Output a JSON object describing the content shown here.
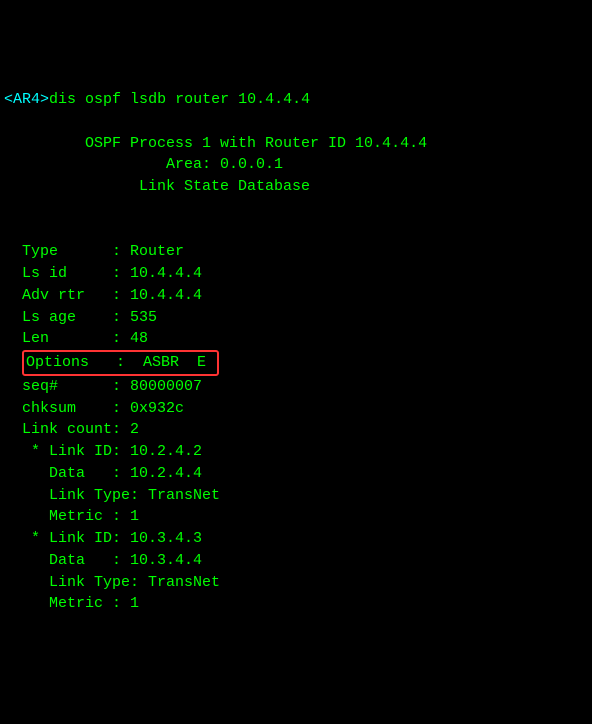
{
  "prompt": {
    "hostname_open": "<",
    "hostname": "AR4",
    "hostname_close": ">",
    "command": "dis ospf lsdb router 10.4.4.4"
  },
  "header": {
    "line1": "         OSPF Process 1 with Router ID 10.4.4.4",
    "line2": "                  Area: 0.0.0.1",
    "line3": "               Link State Database"
  },
  "lsa": {
    "indent": "  ",
    "fields1": {
      "type_key": "Type      ",
      "type_sep": ": ",
      "type_val": "Router",
      "lsid_key": "Ls id     ",
      "lsid_sep": ": ",
      "lsid_val": "10.4.4.4",
      "adv_key": "Adv rtr   ",
      "adv_sep": ": ",
      "adv_val": "10.4.4.4",
      "lsage_key": "Ls age    ",
      "lsage_sep": ": ",
      "lsage_val": "535",
      "len_key": "Len       ",
      "len_sep": ": ",
      "len_val": "48"
    },
    "options": {
      "key": "Options   ",
      "sep": ":",
      "val": "  ASBR  E "
    },
    "fields2": {
      "seq_key": "seq#      ",
      "seq_sep": ": ",
      "seq_val": "80000007",
      "chk_key": "chksum    ",
      "chk_sep": ": ",
      "chk_val": "0x932c",
      "lc_key": "Link count",
      "lc_sep": ": ",
      "lc_val": "2"
    }
  },
  "links": {
    "indent": "   ",
    "sub_indent": "     ",
    "l1": {
      "linkid_key": "* Link ID: ",
      "linkid_val": "10.2.4.2",
      "data_key": "Data   : ",
      "data_val": "10.2.4.4",
      "type_key": "Link Type: ",
      "type_val": "TransNet",
      "metric_key": "Metric : ",
      "metric_val": "1"
    },
    "l2": {
      "linkid_key": "* Link ID: ",
      "linkid_val": "10.3.4.3",
      "data_key": "Data   : ",
      "data_val": "10.3.4.4",
      "type_key": "Link Type: ",
      "type_val": "TransNet",
      "metric_key": "Metric : ",
      "metric_val": "1"
    }
  }
}
